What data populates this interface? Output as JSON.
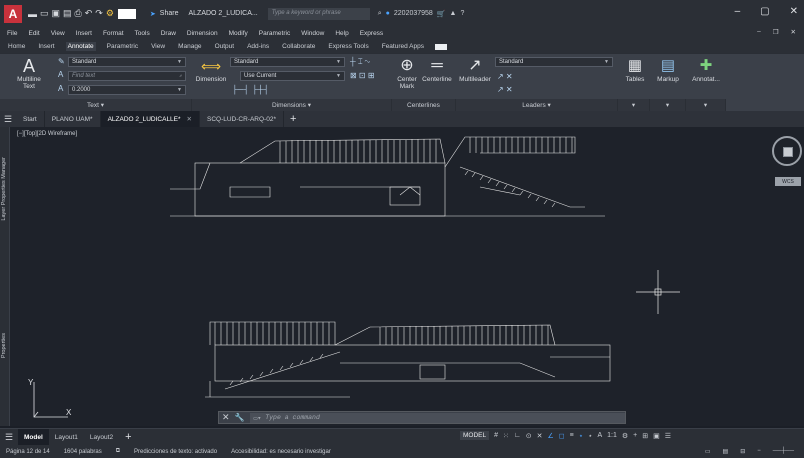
{
  "titlebar": {
    "logo": "A",
    "workspace_value": "",
    "share_label": "Share",
    "document_title": "ALZADO 2_LUDICA...",
    "search_placeholder": "Type a keyword or phrase",
    "username": "2202037958"
  },
  "menu": [
    "File",
    "Edit",
    "View",
    "Insert",
    "Format",
    "Tools",
    "Draw",
    "Dimension",
    "Modify",
    "Parametric",
    "Window",
    "Help",
    "Express"
  ],
  "ribbon_tabs": [
    "Home",
    "Insert",
    "Annotate",
    "Parametric",
    "View",
    "Manage",
    "Output",
    "Add-ins",
    "Collaborate",
    "Express Tools",
    "Featured Apps"
  ],
  "ribbon_active_tab": "Annotate",
  "ribbon": {
    "text_panel": {
      "multiline_text": "Multiline Text",
      "text_style": "Standard",
      "find_text": "Find text",
      "text_height": "0.2000",
      "footer": "Text"
    },
    "dimensions_panel": {
      "dimension_button": "Dimension",
      "dim_style": "Standard",
      "layer": "Use Current",
      "footer": "Dimensions"
    },
    "centerlines_panel": {
      "center_mark": "Center Mark",
      "centerline": "Centerline",
      "footer": "Centerlines"
    },
    "leaders_panel": {
      "multileader": "Multileader",
      "leader_style": "Standard",
      "footer": "Leaders"
    },
    "extra_buttons": [
      "Tables",
      "Markup",
      "Annotat..."
    ]
  },
  "file_tabs": [
    {
      "label": "Start",
      "active": false
    },
    {
      "label": "PLANO UAM*",
      "active": false
    },
    {
      "label": "ALZADO 2_LUDICALLE*",
      "active": true
    },
    {
      "label": "SCQ-LUD-CR-ARQ-02*",
      "active": false
    }
  ],
  "viewport_label": "[−][Top][2D Wireframe]",
  "side_palettes": {
    "upper": "Layer Properties Manager",
    "lower": "Properties"
  },
  "viewcube": {
    "face": "TOP",
    "wcs": "WCS"
  },
  "command_line": {
    "placeholder": "Type a command"
  },
  "layout_tabs": [
    {
      "label": "Model",
      "active": true
    },
    {
      "label": "Layout1",
      "active": false
    },
    {
      "label": "Layout2",
      "active": false
    }
  ],
  "status": {
    "model_label": "MODEL",
    "scale": "1:1"
  },
  "word_status": {
    "page": "Página 12 de 14",
    "words": "1604 palabras",
    "predictions": "Predicciones de texto: activado",
    "accessibility": "Accesibilidad: es necesario investigar"
  }
}
